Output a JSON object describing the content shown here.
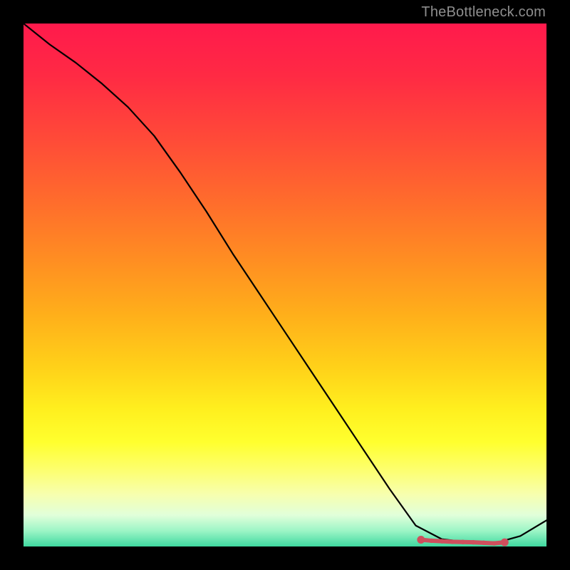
{
  "credit": "TheBottleneck.com",
  "colors": {
    "curve_stroke": "#000000",
    "marker_fill": "#cf4f5d",
    "marker_stroke": "#cf4f5d",
    "background": "#000000"
  },
  "chart_data": {
    "type": "line",
    "title": "",
    "xlabel": "",
    "ylabel": "",
    "xlim": [
      0,
      100
    ],
    "ylim": [
      0,
      100
    ],
    "x": [
      0,
      5,
      10,
      15,
      20,
      25,
      30,
      35,
      40,
      45,
      50,
      55,
      60,
      65,
      70,
      75,
      80,
      85,
      90,
      95,
      100
    ],
    "series": [
      {
        "name": "bottleneck-curve",
        "values": [
          100,
          96,
          92.5,
          88.5,
          84,
          78.5,
          71.5,
          64,
          56,
          48.5,
          41,
          33.5,
          26,
          18.5,
          11,
          4,
          1.4,
          0.8,
          0.6,
          2,
          5
        ]
      }
    ],
    "markers": {
      "name": "highlighted-range",
      "x": [
        76,
        78,
        80,
        82,
        84,
        86,
        88,
        90,
        92
      ],
      "y": [
        1.3,
        1.1,
        1.0,
        0.9,
        0.85,
        0.8,
        0.7,
        0.6,
        0.8
      ]
    }
  }
}
